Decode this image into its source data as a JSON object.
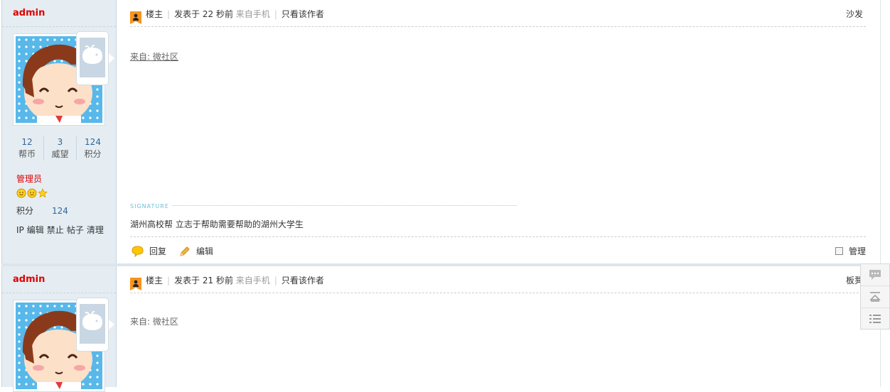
{
  "posts": [
    {
      "author": "admin",
      "stats": [
        {
          "value": "12",
          "label": "帮币"
        },
        {
          "value": "3",
          "label": "威望"
        },
        {
          "value": "124",
          "label": "积分"
        }
      ],
      "usergroup": "管理员",
      "points_label": "积分",
      "points_value": "124",
      "admin_links": [
        "IP",
        "编辑",
        "禁止",
        "帖子",
        "清理"
      ],
      "role": "楼主",
      "posted": "发表于 22 秒前",
      "via": "来自手机",
      "only_author": "只看该作者",
      "floor": "沙发",
      "from_link": "来自: 微社区",
      "signature_heading": "SIGNATURE",
      "signature": "湖州高校帮 立志于帮助需要帮助的湖州大学生",
      "reply": "回复",
      "edit": "编辑",
      "manage": "管理"
    },
    {
      "author": "admin",
      "role": "楼主",
      "posted": "发表于 21 秒前",
      "via": "来自手机",
      "only_author": "只看该作者",
      "floor": "板凳",
      "from_link": "来自: 微社区"
    }
  ],
  "icons": {
    "owner": "owner-badge-icon",
    "reply": "reply-bubble-icon",
    "edit": "pencil-icon",
    "stars": [
      "smiley-icon",
      "smiley-icon",
      "star-icon"
    ],
    "float": [
      "comment-icon",
      "back-to-top-icon",
      "list-icon"
    ]
  },
  "colors": {
    "author": "#e00000",
    "sidebar_bg": "#e5edf2",
    "link_blue": "#336699",
    "signature_heading": "#6cc0d8"
  }
}
